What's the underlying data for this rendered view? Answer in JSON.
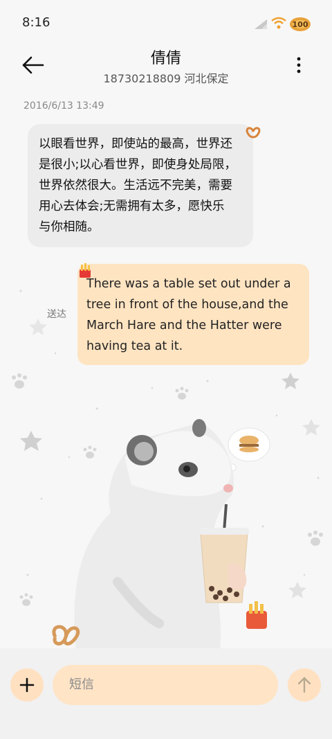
{
  "status": {
    "time": "8:16",
    "battery_label": "100"
  },
  "header": {
    "name": "倩倩",
    "subtitle": "18730218809 河北保定"
  },
  "conversation": {
    "timestamp": "2016/6/13 13:49",
    "incoming": {
      "lines": [
        "以眼看世界，即使站的最高，世界还",
        "是很小;以心看世界，即使身处局限，",
        "世界依然很大。生活远不完美，需要",
        "用心去体会;无需拥有太多，愿快乐",
        "与你相随。"
      ]
    },
    "outgoing": {
      "lines": [
        "There was a table set out under a",
        "tree in front of the house,and the",
        "March Hare and the Hatter were",
        "having tea at it."
      ],
      "status": "送达"
    }
  },
  "composer": {
    "placeholder": "短信"
  },
  "colors": {
    "accent": "#ffe1c2",
    "bubble_in": "#ececec",
    "bubble_out": "#ffe4c2"
  }
}
